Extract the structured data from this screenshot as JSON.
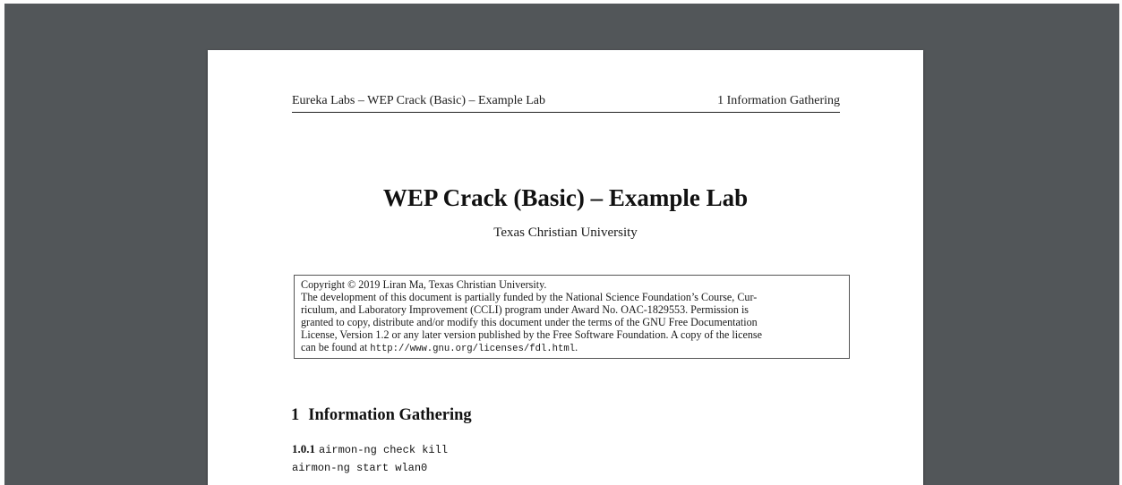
{
  "header": {
    "left": "Eureka Labs – WEP Crack (Basic) – Example Lab",
    "right": "1  Information Gathering"
  },
  "title": "WEP Crack (Basic) – Example Lab",
  "subtitle": "Texas Christian University",
  "copyright": {
    "line1": "Copyright © 2019  Liran Ma, Texas Christian University.",
    "line2": "The development of this document is partially funded by the National Science Foundation’s Course, Cur-",
    "line3": "riculum, and Laboratory Improvement (CCLI) program under Award No.  OAC-1829553.  Permission is",
    "line4": "granted to copy, distribute and/or modify this document under the terms of the GNU Free Documentation",
    "line5": "License, Version 1.2 or any later version published by the Free Software Foundation.  A copy of the license",
    "line6_prefix": "can be found at ",
    "line6_url": "http://www.gnu.org/licenses/fdl.html",
    "line6_suffix": "."
  },
  "section": {
    "number": "1",
    "title": "Information Gathering",
    "sub_number": "1.0.1",
    "command1": "airmon-ng check kill",
    "command2": "airmon-ng start wlan0"
  },
  "colors": {
    "viewer_background": "#525659",
    "page_background": "#ffffff"
  }
}
